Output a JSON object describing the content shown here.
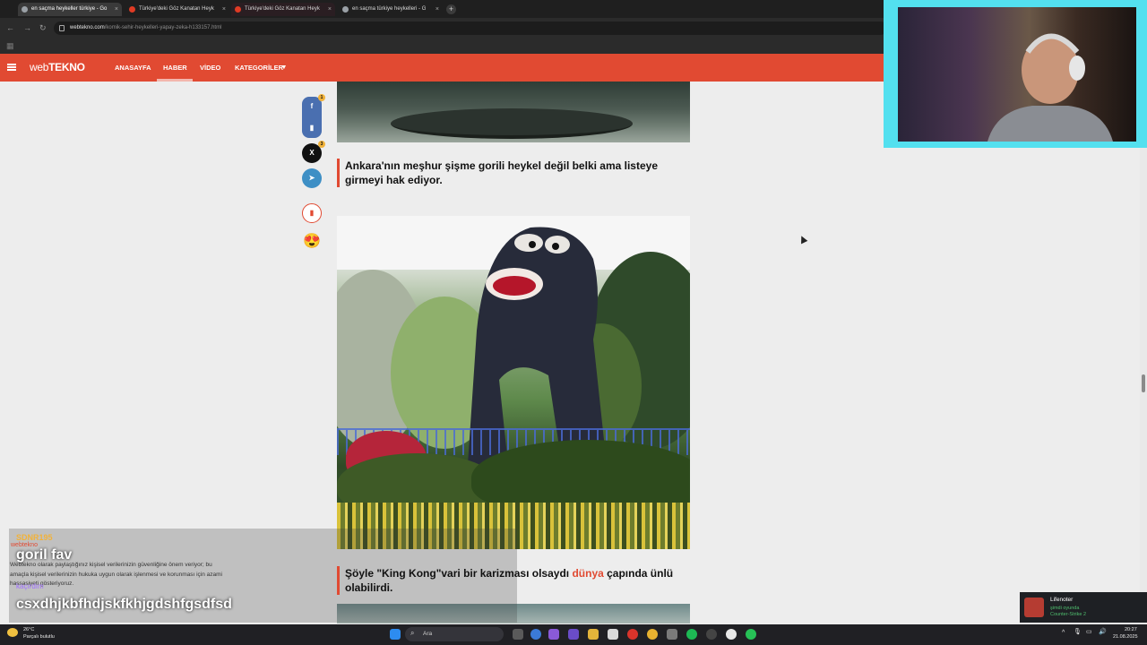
{
  "browser": {
    "tabs": [
      {
        "title": "en saçma heykeller türkiye - Go",
        "close": "×"
      },
      {
        "title": "Türkiye'deki Göz Kanatan Heyk",
        "close": "×"
      },
      {
        "title": "Türkiye'deki Göz Kanatan Heyk",
        "close": "×"
      },
      {
        "title": "en saçma türkiye heykelleri - G",
        "close": "×"
      }
    ],
    "new_tab": "+",
    "address": {
      "domain": "webtekno.com",
      "path": "/komik-sehir-heykelleri-yapay-zeka-h133157.html"
    }
  },
  "site": {
    "logo_a": "web",
    "logo_b": "TEKNO",
    "nav": [
      "ANASAYFA",
      "HABER",
      "VİDEO",
      "KATEGORİLER"
    ],
    "nav_arrow": "▾"
  },
  "article": {
    "caption1": "Ankara'nın meşhur şişme gorili heykel değil belki ama listeye girmeyi hak ediyor.",
    "caption2_pre": "Şöyle \"King Kong\"vari bir karizması olsaydı ",
    "caption2_link": "dünya",
    "caption2_post": " çapında ünlü olabilirdi."
  },
  "share": {
    "facebook": "f",
    "bookmark": "▮",
    "x": "X",
    "telegram": "➤",
    "save": "▮",
    "emoji": "😍",
    "badge_fb": "1",
    "badge_x": "3"
  },
  "chat": {
    "user1": "SDNR195",
    "message1": "goril fav",
    "user2": "kaçırdım",
    "message2": "csxdhjkbfhdjskfkhjgdshfgsdfsd",
    "cookie_logo": "webtekno",
    "cookie_text": "Webtekno olarak paylaştığınız kişisel verilerinizin güvenliğine önem veriyor; bu amaçla kişisel verilerinizin hukuka uygun olarak işlenmesi ve korunması için azami hassasiyeti gösteriyoruz."
  },
  "notification": {
    "name": "Lifenoter",
    "status": "şimdi oyunda",
    "game": "Counter-Strike 2"
  },
  "taskbar": {
    "weather_temp": "26°C",
    "weather_desc": "Parçalı bulutlu",
    "search": "Ara",
    "time": "20:27",
    "date": "21.08.2025"
  },
  "colors": {
    "brand": "#e14a32",
    "badge": "#f1b23a"
  }
}
